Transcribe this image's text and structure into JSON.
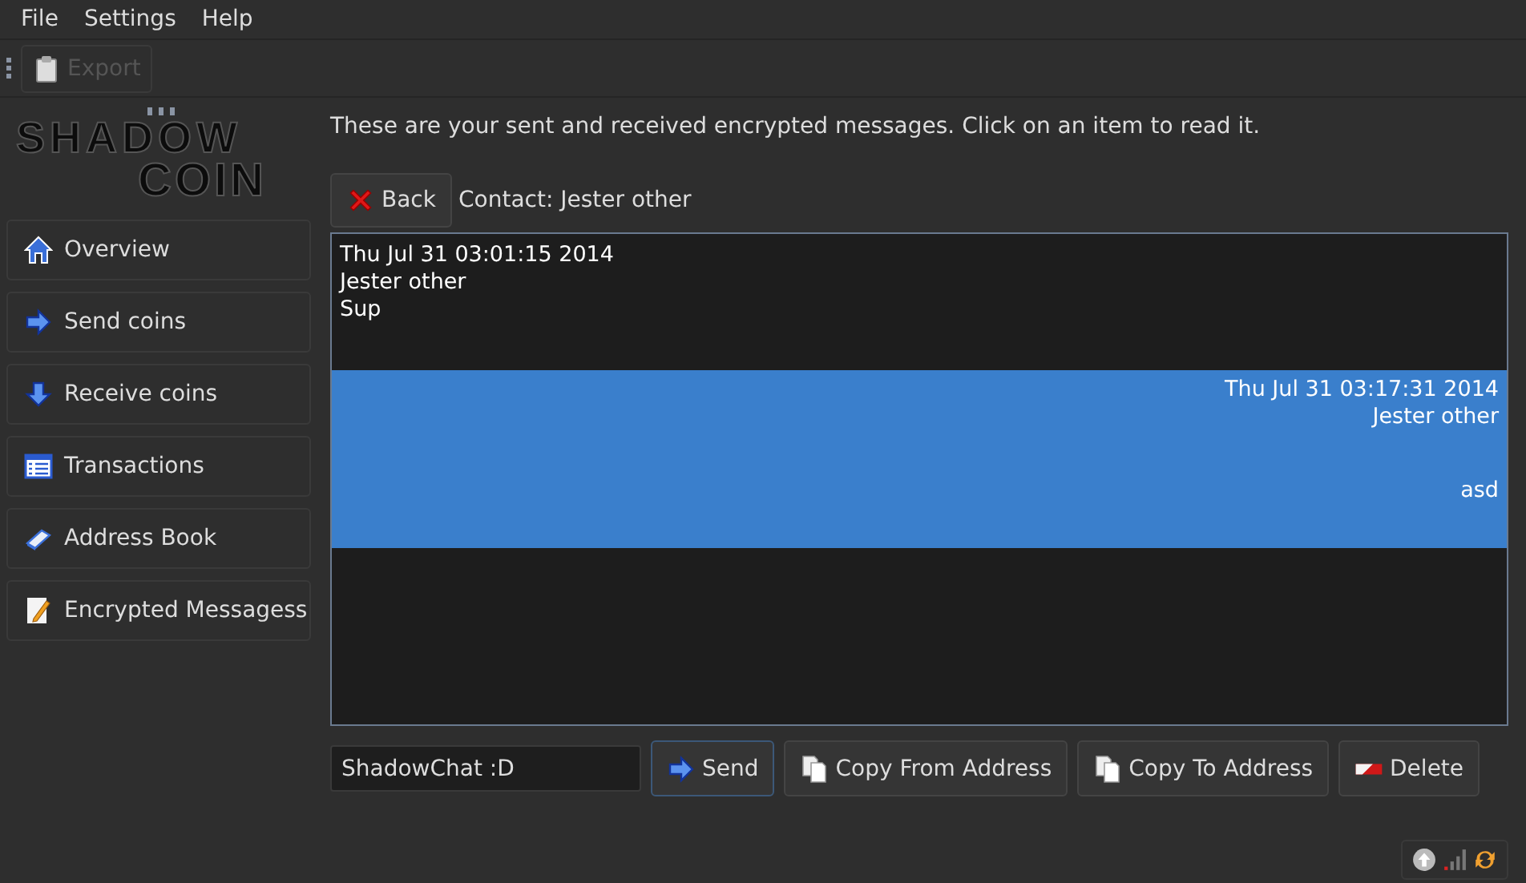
{
  "menu": [
    "File",
    "Settings",
    "Help"
  ],
  "toolbar": {
    "export": {
      "label": "Export",
      "disabled": true
    }
  },
  "logo": {
    "line_1": "SHADOW",
    "line_2": "COIN"
  },
  "sidebar": {
    "items": [
      {
        "label": "Overview"
      },
      {
        "label": "Send coins"
      },
      {
        "label": "Receive coins"
      },
      {
        "label": "Transactions"
      },
      {
        "label": "Address Book"
      },
      {
        "label": "Encrypted Messagess"
      }
    ]
  },
  "intro": "These are your sent and received encrypted messages. Click on an item to read it.",
  "back_button": "Back",
  "contact": "Contact: Jester other",
  "messages": [
    {
      "kind": "received",
      "time": "Thu Jul 31 03:01:15 2014",
      "from": "Jester other",
      "text": "Sup",
      "selected": false
    },
    {
      "kind": "sent",
      "time": "Thu Jul 31 03:17:31 2014",
      "from": "Jester other",
      "text": "asd",
      "selected": true
    }
  ],
  "compose": {
    "value": "ShadowChat :D"
  },
  "buttons": [
    {
      "label": "Send"
    },
    {
      "label": "Copy From Address"
    },
    {
      "label": "Copy To Address"
    },
    {
      "label": "Delete"
    }
  ]
}
